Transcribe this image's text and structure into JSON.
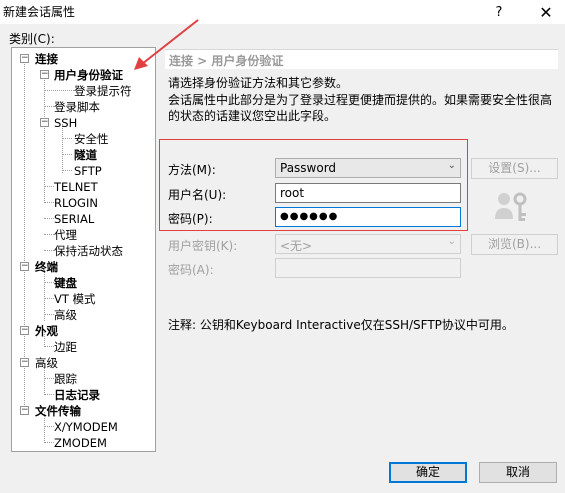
{
  "window": {
    "title": "新建会话属性",
    "help_label": "?",
    "close_label": "✕"
  },
  "category_label": "类别(C):",
  "tree": {
    "connection": "连接",
    "auth": "用户身份验证",
    "login_prompt": "登录提示符",
    "login_script": "登录脚本",
    "ssh": "SSH",
    "security": "安全性",
    "tunnel": "隧道",
    "sftp": "SFTP",
    "telnet": "TELNET",
    "rlogin": "RLOGIN",
    "serial": "SERIAL",
    "proxy": "代理",
    "keepalive": "保持活动状态",
    "terminal": "终端",
    "keyboard": "键盘",
    "vt_mode": "VT 模式",
    "advanced1": "高级",
    "appearance": "外观",
    "margin": "边距",
    "advanced2": "高级",
    "trace": "跟踪",
    "logging": "日志记录",
    "file_transfer": "文件传输",
    "xymodem": "X/YMODEM",
    "zmodem": "ZMODEM"
  },
  "main": {
    "breadcrumb": "连接 > 用户身份验证",
    "desc1": "请选择身份验证方法和其它参数。",
    "desc2": "会话属性中此部分是为了登录过程更便捷而提供的。如果需要安全性很高的状态的话建议您空出此字段。",
    "method_label": "方法(M):",
    "method_value": "Password",
    "settings_button": "设置(S)...",
    "username_label": "用户名(U):",
    "username_value": "root",
    "password_label": "密码(P):",
    "password_value": "●●●●●●",
    "user_key_label": "用户密钥(K):",
    "user_key_value": "<无>",
    "browse_button": "浏览(B)...",
    "passphrase_label": "密码(A):",
    "note": "注释: 公钥和Keyboard Interactive仅在SSH/SFTP协议中可用。"
  },
  "footer": {
    "ok": "确定",
    "cancel": "取消"
  },
  "colors": {
    "highlight_box": "#e04040",
    "arrow": "#e04040",
    "focus": "#0078d7"
  }
}
